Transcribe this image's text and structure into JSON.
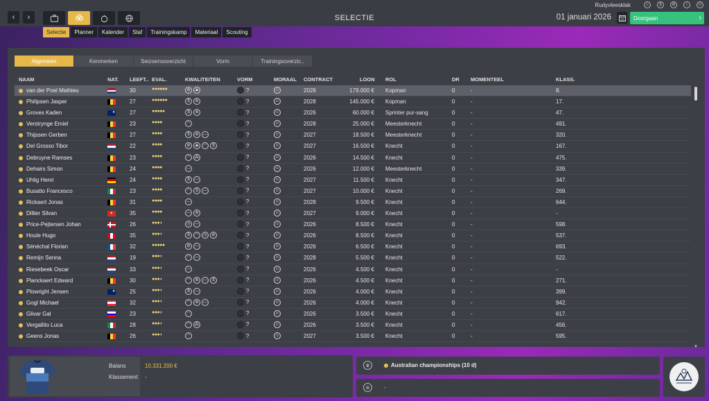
{
  "user": {
    "name": "Rudyvleesklak"
  },
  "system_icons": [
    "user-icon",
    "coin-icon",
    "settings-icon",
    "info-icon",
    "power-icon"
  ],
  "nav": {
    "prev_icon": "chevron-left-icon",
    "next_icon": "chevron-right-icon"
  },
  "main_tabs": [
    {
      "icon": "briefcase-icon",
      "active": false
    },
    {
      "icon": "team-icon",
      "active": true
    },
    {
      "icon": "stopwatch-icon",
      "active": false
    },
    {
      "icon": "globe-icon",
      "active": false
    }
  ],
  "page_title": "SELECTIE",
  "date": "01 januari 2026",
  "continue_label": "Doorgaan",
  "sub_tabs": [
    {
      "label": "Selectie",
      "active": true
    },
    {
      "label": "Planner",
      "active": false
    },
    {
      "label": "Kalender",
      "active": false
    },
    {
      "label": "Staf",
      "active": false
    },
    {
      "label": "Trainingskamp",
      "active": false
    },
    {
      "label": "Materiaal",
      "active": false
    },
    {
      "label": "Scouting",
      "active": false
    }
  ],
  "view_tabs": [
    {
      "label": "Algemeen",
      "active": true
    },
    {
      "label": "Kenmerken",
      "active": false
    },
    {
      "label": "Seizoensoverzicht",
      "active": false
    },
    {
      "label": "Vorm",
      "active": false
    },
    {
      "label": "Trainingsoverzic..",
      "active": false
    }
  ],
  "columns": {
    "naam": "NAAM",
    "nat": "NAT.",
    "leeftijd": "LEEFT..",
    "eval": "EVAL.",
    "kwaliteiten": "KWALITEITEN",
    "vorm": "VORM",
    "moraal": "MORAAL",
    "contract": "CONTRACT",
    "loon": "LOON",
    "rol": "ROL",
    "dr": "DR",
    "momenteel": "MOMENTEEL",
    "klass": "KLASS."
  },
  "riders": [
    {
      "name": "van der Poel Mathieu",
      "flag": "nl",
      "age": "30",
      "eval": "●●●●●●",
      "quals": [
        "W",
        "M"
      ],
      "vorm": "?",
      "contract": "2028",
      "loon": "179.000 €",
      "rol": "Kopman",
      "dr": "0",
      "mom": "-",
      "klass": "8."
    },
    {
      "name": "Philipsen Jasper",
      "flag": "be",
      "age": "27",
      "eval": "●●●●●●",
      "quals": [
        "S",
        "W"
      ],
      "vorm": "?",
      "contract": "2028",
      "loon": "145.000 €",
      "rol": "Kopman",
      "dr": "0",
      "mom": "-",
      "klass": "17."
    },
    {
      "name": "Groves Kaden",
      "flag": "au",
      "age": "27",
      "eval": "●●●●●",
      "quals": [
        "S",
        "W"
      ],
      "vorm": "?",
      "contract": "2026",
      "loon": "60.000 €",
      "rol": "Sprinter pur-sang",
      "dr": "0",
      "mom": "-",
      "klass": "47."
    },
    {
      "name": "Verstrynge Emiel",
      "flag": "be",
      "age": "23",
      "eval": "●●●●",
      "quals": [
        "H"
      ],
      "vorm": "?",
      "contract": "2028",
      "loon": "25.000 €",
      "rol": "Meesterknecht",
      "dr": "0",
      "mom": "-",
      "klass": "491."
    },
    {
      "name": "Thijssen Gerben",
      "flag": "be",
      "age": "27",
      "eval": "●●●●",
      "quals": [
        "S",
        "W",
        "F"
      ],
      "vorm": "?",
      "contract": "2027",
      "loon": "18.500 €",
      "rol": "Meesterknecht",
      "dr": "0",
      "mom": "-",
      "klass": "320."
    },
    {
      "name": "Del Grosso Tibor",
      "flag": "nl",
      "age": "22",
      "eval": "●●●●",
      "quals": [
        "W",
        "M",
        "H",
        "S"
      ],
      "vorm": "?",
      "contract": "2027",
      "loon": "16.500 €",
      "rol": "Knecht",
      "dr": "0",
      "mom": "-",
      "klass": "167."
    },
    {
      "name": "Debruyne Ramses",
      "flag": "be",
      "age": "23",
      "eval": "●●●●",
      "quals": [
        "H",
        "C"
      ],
      "vorm": "?",
      "contract": "2026",
      "loon": "14.500 €",
      "rol": "Knecht",
      "dr": "0",
      "mom": "-",
      "klass": "475."
    },
    {
      "name": "Dehairs Simon",
      "flag": "be",
      "age": "24",
      "eval": "●●●●",
      "quals": [
        "F"
      ],
      "vorm": "?",
      "contract": "2026",
      "loon": "12.000 €",
      "rol": "Meesterknecht",
      "dr": "0",
      "mom": "-",
      "klass": "339."
    },
    {
      "name": "Uhlig Henri",
      "flag": "de",
      "age": "24",
      "eval": "●●●●",
      "quals": [
        "S",
        "F"
      ],
      "vorm": "?",
      "contract": "2027",
      "loon": "11.500 €",
      "rol": "Knecht",
      "dr": "0",
      "mom": "-",
      "klass": "347."
    },
    {
      "name": "Busatto Francesco",
      "flag": "it",
      "age": "23",
      "eval": "●●●●",
      "quals": [
        "H",
        "S",
        "F"
      ],
      "vorm": "?",
      "contract": "2027",
      "loon": "10.000 €",
      "rol": "Knecht",
      "dr": "0",
      "mom": "-",
      "klass": "269."
    },
    {
      "name": "Rickaert Jonas",
      "flag": "be",
      "age": "31",
      "eval": "●●●●",
      "quals": [
        "F"
      ],
      "vorm": "?",
      "contract": "2028",
      "loon": "9.500 €",
      "rol": "Knecht",
      "dr": "0",
      "mom": "-",
      "klass": "644."
    },
    {
      "name": "Dillier Silvan",
      "flag": "ch",
      "age": "35",
      "eval": "●●●●",
      "quals": [
        "F",
        "W"
      ],
      "vorm": "?",
      "contract": "2027",
      "loon": "9.000 €",
      "rol": "Knecht",
      "dr": "0",
      "mom": "-",
      "klass": "-"
    },
    {
      "name": "Price-Pejtersen Johan",
      "flag": "dk",
      "age": "26",
      "eval": "●●●◖",
      "quals": [
        "T",
        "F"
      ],
      "vorm": "?",
      "contract": "2026",
      "loon": "8.500 €",
      "rol": "Knecht",
      "dr": "0",
      "mom": "-",
      "klass": "598."
    },
    {
      "name": "Houle Hugo",
      "flag": "ca",
      "age": "35",
      "eval": "●●●◖",
      "quals": [
        "S",
        "H",
        "T",
        "W"
      ],
      "vorm": "?",
      "contract": "2026",
      "loon": "8.500 €",
      "rol": "Knecht",
      "dr": "0",
      "mom": "-",
      "klass": "537."
    },
    {
      "name": "Sénéchal Florian",
      "flag": "fr",
      "age": "32",
      "eval": "●●●●●",
      "quals": [
        "W",
        "F"
      ],
      "vorm": "?",
      "contract": "2026",
      "loon": "6.500 €",
      "rol": "Knecht",
      "dr": "0",
      "mom": "-",
      "klass": "693."
    },
    {
      "name": "Remijn Senna",
      "flag": "nl",
      "age": "19",
      "eval": "●●●◖",
      "quals": [
        "H",
        "F"
      ],
      "vorm": "?",
      "contract": "2028",
      "loon": "5.500 €",
      "rol": "Knecht",
      "dr": "0",
      "mom": "-",
      "klass": "522."
    },
    {
      "name": "Riesebeek Oscar",
      "flag": "nl",
      "age": "33",
      "eval": "●●●◖",
      "quals": [
        "F"
      ],
      "vorm": "?",
      "contract": "2026",
      "loon": "4.500 €",
      "rol": "Knecht",
      "dr": "0",
      "mom": "-",
      "klass": "-"
    },
    {
      "name": "Planckaert Edward",
      "flag": "be",
      "age": "30",
      "eval": "●●●◖",
      "quals": [
        "H",
        "W",
        "F",
        "S"
      ],
      "vorm": "?",
      "contract": "2026",
      "loon": "4.500 €",
      "rol": "Knecht",
      "dr": "0",
      "mom": "-",
      "klass": "271."
    },
    {
      "name": "Plowright Jensen",
      "flag": "au",
      "age": "25",
      "eval": "●●●◖",
      "quals": [
        "S",
        "F"
      ],
      "vorm": "?",
      "contract": "2026",
      "loon": "4.000 €",
      "rol": "Knecht",
      "dr": "0",
      "mom": "-",
      "klass": "399."
    },
    {
      "name": "Gogl Michael",
      "flag": "at",
      "age": "32",
      "eval": "●●●◖",
      "quals": [
        "H",
        "W",
        "F"
      ],
      "vorm": "?",
      "contract": "2026",
      "loon": "4.000 €",
      "rol": "Knecht",
      "dr": "0",
      "mom": "-",
      "klass": "942."
    },
    {
      "name": "Glivar Gal",
      "flag": "si",
      "age": "23",
      "eval": "●●●◖",
      "quals": [
        "H"
      ],
      "vorm": "?",
      "contract": "2026",
      "loon": "3.500 €",
      "rol": "Knecht",
      "dr": "0",
      "mom": "-",
      "klass": "617."
    },
    {
      "name": "Vergallito Luca",
      "flag": "it",
      "age": "28",
      "eval": "●●●◖",
      "quals": [
        "H",
        "C"
      ],
      "vorm": "?",
      "contract": "2026",
      "loon": "3.500 €",
      "rol": "Knecht",
      "dr": "0",
      "mom": "-",
      "klass": "456."
    },
    {
      "name": "Geens Jonas",
      "flag": "be",
      "age": "26",
      "eval": "●●●◖",
      "quals": [
        "H"
      ],
      "vorm": "?",
      "contract": "2027",
      "loon": "3.500 €",
      "rol": "Knecht",
      "dr": "0",
      "mom": "-",
      "klass": "595."
    }
  ],
  "footer": {
    "balans_label": "Balans",
    "balans_value": "10.331.200 €",
    "klassement_label": "Klassement",
    "klassement_value": "-",
    "event_text": "Australian championships (10 d)",
    "event2_text": "-"
  },
  "colors": {
    "accent": "#e6b84a",
    "continue": "#35c27c",
    "panel": "#3c3f45"
  }
}
